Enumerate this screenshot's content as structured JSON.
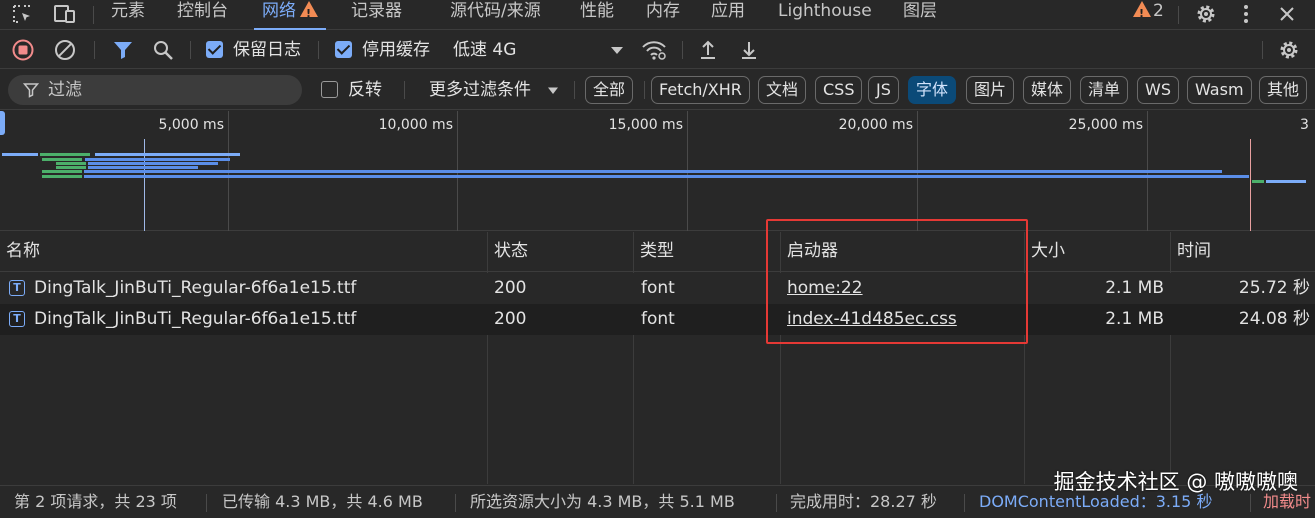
{
  "colors": {
    "accent": "#7cacf8",
    "warning": "#f28b54",
    "record_red": "#f28b8b",
    "active_chip_bg": "#0b4a78",
    "highlight_box": "#e53935",
    "dom_content_loaded": "#7cacf8",
    "load": "#f28b8b"
  },
  "tabs": [
    {
      "label": "元素"
    },
    {
      "label": "控制台"
    },
    {
      "label": "网络",
      "active": true,
      "icon": "warning-icon"
    },
    {
      "label": "记录器"
    },
    {
      "label": "源代码/来源"
    },
    {
      "label": "性能"
    },
    {
      "label": "内存"
    },
    {
      "label": "应用"
    },
    {
      "label": "Lighthouse"
    },
    {
      "label": "图层"
    }
  ],
  "tabbar": {
    "warning_count": "2",
    "icons": [
      "inspect-element-icon",
      "device-toolbar-icon",
      "settings-gear-icon",
      "more-vertical-icon",
      "close-icon"
    ]
  },
  "toolbar": {
    "icons": [
      "record-stop-icon",
      "clear-icon",
      "filter-funnel-icon",
      "search-icon",
      "network-conditions-icon",
      "import-har-icon",
      "export-har-icon",
      "network-settings-icon"
    ],
    "preserve_log": {
      "label": "保留日志",
      "checked": true
    },
    "disable_cache": {
      "label": "停用缓存",
      "checked": true
    },
    "throttling": "低速 4G"
  },
  "filterbar": {
    "placeholder": "过滤",
    "invert": {
      "label": "反转",
      "checked": false
    },
    "more_filters": "更多过滤条件",
    "chips": [
      {
        "label": "全部"
      },
      {
        "label": "Fetch/XHR"
      },
      {
        "label": "文档"
      },
      {
        "label": "CSS"
      },
      {
        "label": "JS"
      },
      {
        "label": "字体",
        "active": true
      },
      {
        "label": "图片"
      },
      {
        "label": "媒体"
      },
      {
        "label": "清单"
      },
      {
        "label": "WS"
      },
      {
        "label": "Wasm"
      },
      {
        "label": "其他"
      }
    ]
  },
  "overview": {
    "tick_labels": [
      "5,000 ms",
      "10,000 ms",
      "15,000 ms",
      "20,000 ms",
      "25,000 ms",
      "3"
    ]
  },
  "table": {
    "columns": [
      "名称",
      "状态",
      "类型",
      "启动器",
      "大小",
      "时间"
    ],
    "rows": [
      {
        "name": "DingTalk_JinBuTi_Regular-6f6a1e15.ttf",
        "status": "200",
        "type": "font",
        "initiator": "home:22",
        "size": "2.1 MB",
        "time": "25.72 秒"
      },
      {
        "name": "DingTalk_JinBuTi_Regular-6f6a1e15.ttf",
        "status": "200",
        "type": "font",
        "initiator": "index-41d485ec.css",
        "size": "2.1 MB",
        "time": "24.08 秒"
      }
    ]
  },
  "statusbar": {
    "requests": "第 2 项请求，共 23 项",
    "transferred": "已传输 4.3 MB，共 4.6 MB",
    "resources": "所选资源大小为 4.3 MB，共 5.1 MB",
    "finish": "完成用时：28.27 秒",
    "dcl": "DOMContentLoaded：3.15 秒",
    "load": "加载时"
  },
  "watermark": "掘金技术社区 @ 嗷嗷嗷噢"
}
